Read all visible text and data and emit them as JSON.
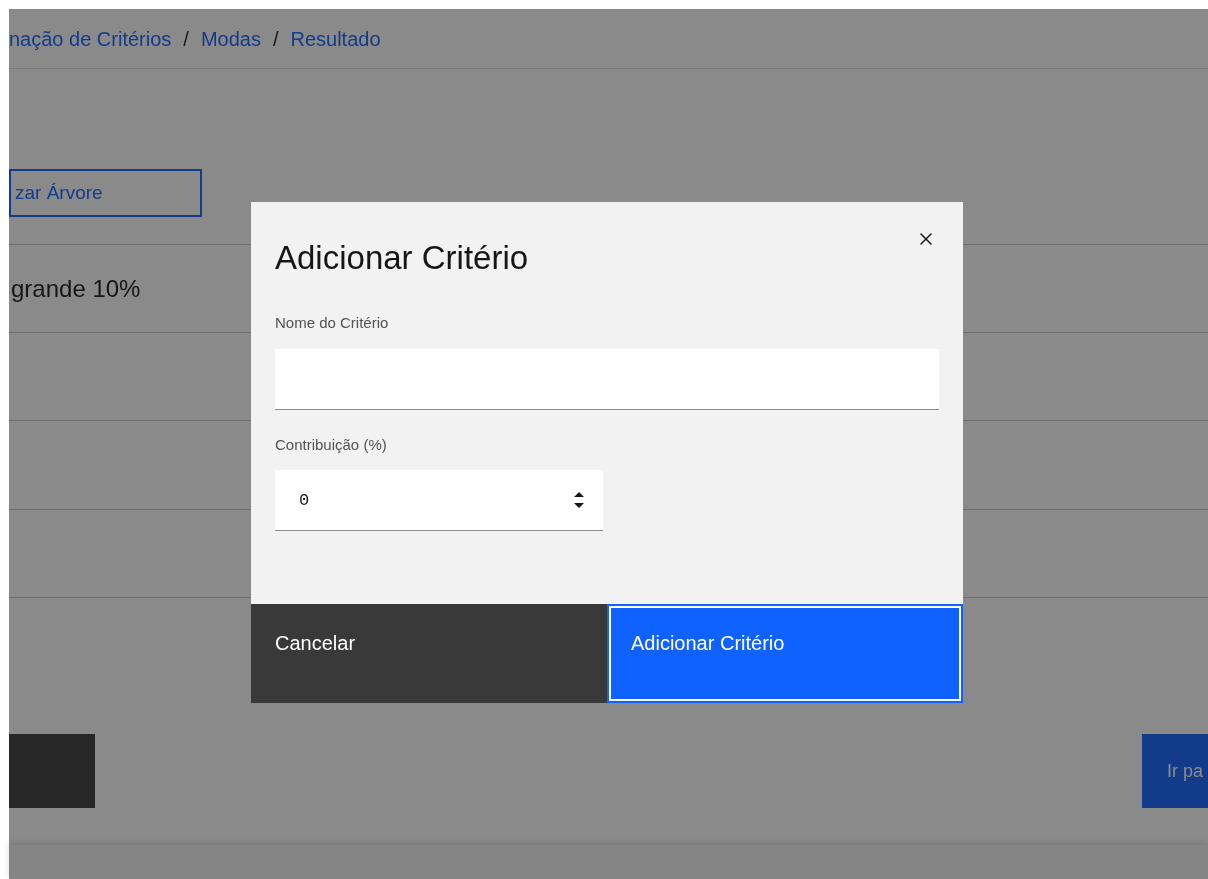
{
  "breadcrumb": [
    {
      "kind": "link",
      "text": "nação de Critérios"
    },
    {
      "kind": "separator",
      "text": "/"
    },
    {
      "kind": "link",
      "text": "Modas"
    },
    {
      "kind": "separator",
      "text": "/"
    },
    {
      "kind": "link",
      "text": "Resultado"
    }
  ],
  "tree_button": "zar Árvore",
  "first_row": "grande 10%",
  "next_button": "Ir pa",
  "modal": {
    "title": "Adicionar Critério",
    "fields": [
      {
        "kind": "text",
        "label": "Nome do Critério"
      },
      {
        "kind": "number",
        "label": "Contribuição (%)",
        "value": "0"
      }
    ],
    "buttons": [
      {
        "kind": "secondary",
        "label": "Cancelar",
        "focused": false
      },
      {
        "kind": "primary",
        "label": "Adicionar Critério",
        "focused": true
      }
    ]
  }
}
